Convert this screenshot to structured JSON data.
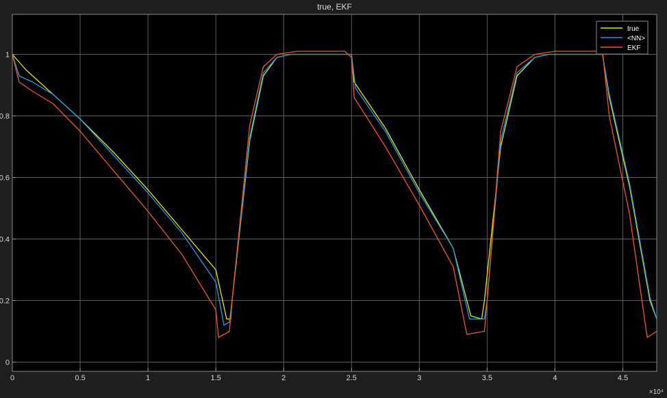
{
  "chart_data": {
    "type": "line",
    "title": "true, EKF",
    "xlabel": "",
    "ylabel": "",
    "xlim": [
      0,
      4.75
    ],
    "ylim": [
      -0.03,
      1.13
    ],
    "x_exponent": "×10⁴",
    "grid": true,
    "legend_position": "top-right",
    "xticks": [
      0,
      0.5,
      1,
      1.5,
      2,
      2.5,
      3,
      3.5,
      4,
      4.5
    ],
    "xtick_labels": [
      "0",
      "0.5",
      "1",
      "1.5",
      "2",
      "2.5",
      "3",
      "3.5",
      "4",
      "4.5"
    ],
    "yticks": [
      0,
      0.2,
      0.4,
      0.6,
      0.8,
      1
    ],
    "ytick_labels": [
      "0",
      "0.2",
      "0.4",
      "0.6",
      "0.8",
      "1"
    ],
    "series": [
      {
        "name": "true",
        "color": "#e8e800",
        "points": [
          [
            0,
            1.0
          ],
          [
            0.1,
            0.95
          ],
          [
            0.25,
            0.89
          ],
          [
            0.5,
            0.79
          ],
          [
            0.75,
            0.68
          ],
          [
            1.0,
            0.56
          ],
          [
            1.25,
            0.43
          ],
          [
            1.5,
            0.3
          ],
          [
            1.58,
            0.14
          ],
          [
            1.61,
            0.14
          ],
          [
            1.62,
            0.2
          ],
          [
            1.75,
            0.72
          ],
          [
            1.85,
            0.93
          ],
          [
            1.95,
            0.99
          ],
          [
            2.05,
            1.0
          ],
          [
            2.5,
            1.0
          ],
          [
            2.52,
            0.91
          ],
          [
            2.75,
            0.76
          ],
          [
            3.0,
            0.56
          ],
          [
            3.25,
            0.37
          ],
          [
            3.38,
            0.15
          ],
          [
            3.46,
            0.14
          ],
          [
            3.48,
            0.2
          ],
          [
            3.6,
            0.7
          ],
          [
            3.72,
            0.93
          ],
          [
            3.85,
            0.99
          ],
          [
            3.95,
            1.0
          ],
          [
            4.35,
            1.0
          ],
          [
            4.4,
            0.86
          ],
          [
            4.55,
            0.57
          ],
          [
            4.7,
            0.2
          ],
          [
            4.75,
            0.14
          ]
        ]
      },
      {
        "name": "<NN>",
        "color": "#1f9be8",
        "points": [
          [
            0,
            1.0
          ],
          [
            0.05,
            0.93
          ],
          [
            0.15,
            0.91
          ],
          [
            0.3,
            0.87
          ],
          [
            0.5,
            0.79
          ],
          [
            0.75,
            0.67
          ],
          [
            1.0,
            0.55
          ],
          [
            1.25,
            0.42
          ],
          [
            1.5,
            0.26
          ],
          [
            1.56,
            0.12
          ],
          [
            1.6,
            0.13
          ],
          [
            1.62,
            0.2
          ],
          [
            1.75,
            0.73
          ],
          [
            1.85,
            0.94
          ],
          [
            1.95,
            0.99
          ],
          [
            2.05,
            1.0
          ],
          [
            2.5,
            1.0
          ],
          [
            2.53,
            0.89
          ],
          [
            2.75,
            0.75
          ],
          [
            3.0,
            0.55
          ],
          [
            3.25,
            0.37
          ],
          [
            3.37,
            0.14
          ],
          [
            3.48,
            0.14
          ],
          [
            3.5,
            0.2
          ],
          [
            3.6,
            0.72
          ],
          [
            3.72,
            0.94
          ],
          [
            3.85,
            0.99
          ],
          [
            3.95,
            1.0
          ],
          [
            4.35,
            1.0
          ],
          [
            4.4,
            0.87
          ],
          [
            4.55,
            0.58
          ],
          [
            4.7,
            0.21
          ],
          [
            4.75,
            0.14
          ]
        ]
      },
      {
        "name": "EKF",
        "color": "#f05a1a",
        "points": [
          [
            0,
            1.0
          ],
          [
            0.05,
            0.91
          ],
          [
            0.15,
            0.88
          ],
          [
            0.3,
            0.84
          ],
          [
            0.5,
            0.75
          ],
          [
            0.75,
            0.62
          ],
          [
            1.0,
            0.49
          ],
          [
            1.25,
            0.35
          ],
          [
            1.5,
            0.17
          ],
          [
            1.52,
            0.08
          ],
          [
            1.6,
            0.1
          ],
          [
            1.62,
            0.2
          ],
          [
            1.75,
            0.77
          ],
          [
            1.85,
            0.96
          ],
          [
            1.95,
            1.0
          ],
          [
            2.1,
            1.01
          ],
          [
            2.45,
            1.01
          ],
          [
            2.5,
            0.99
          ],
          [
            2.52,
            0.86
          ],
          [
            2.75,
            0.7
          ],
          [
            3.0,
            0.51
          ],
          [
            3.25,
            0.31
          ],
          [
            3.35,
            0.09
          ],
          [
            3.48,
            0.1
          ],
          [
            3.5,
            0.2
          ],
          [
            3.6,
            0.75
          ],
          [
            3.72,
            0.96
          ],
          [
            3.85,
            1.0
          ],
          [
            4.0,
            1.01
          ],
          [
            4.35,
            1.01
          ],
          [
            4.4,
            0.8
          ],
          [
            4.55,
            0.48
          ],
          [
            4.68,
            0.08
          ],
          [
            4.75,
            0.1
          ]
        ]
      }
    ]
  }
}
